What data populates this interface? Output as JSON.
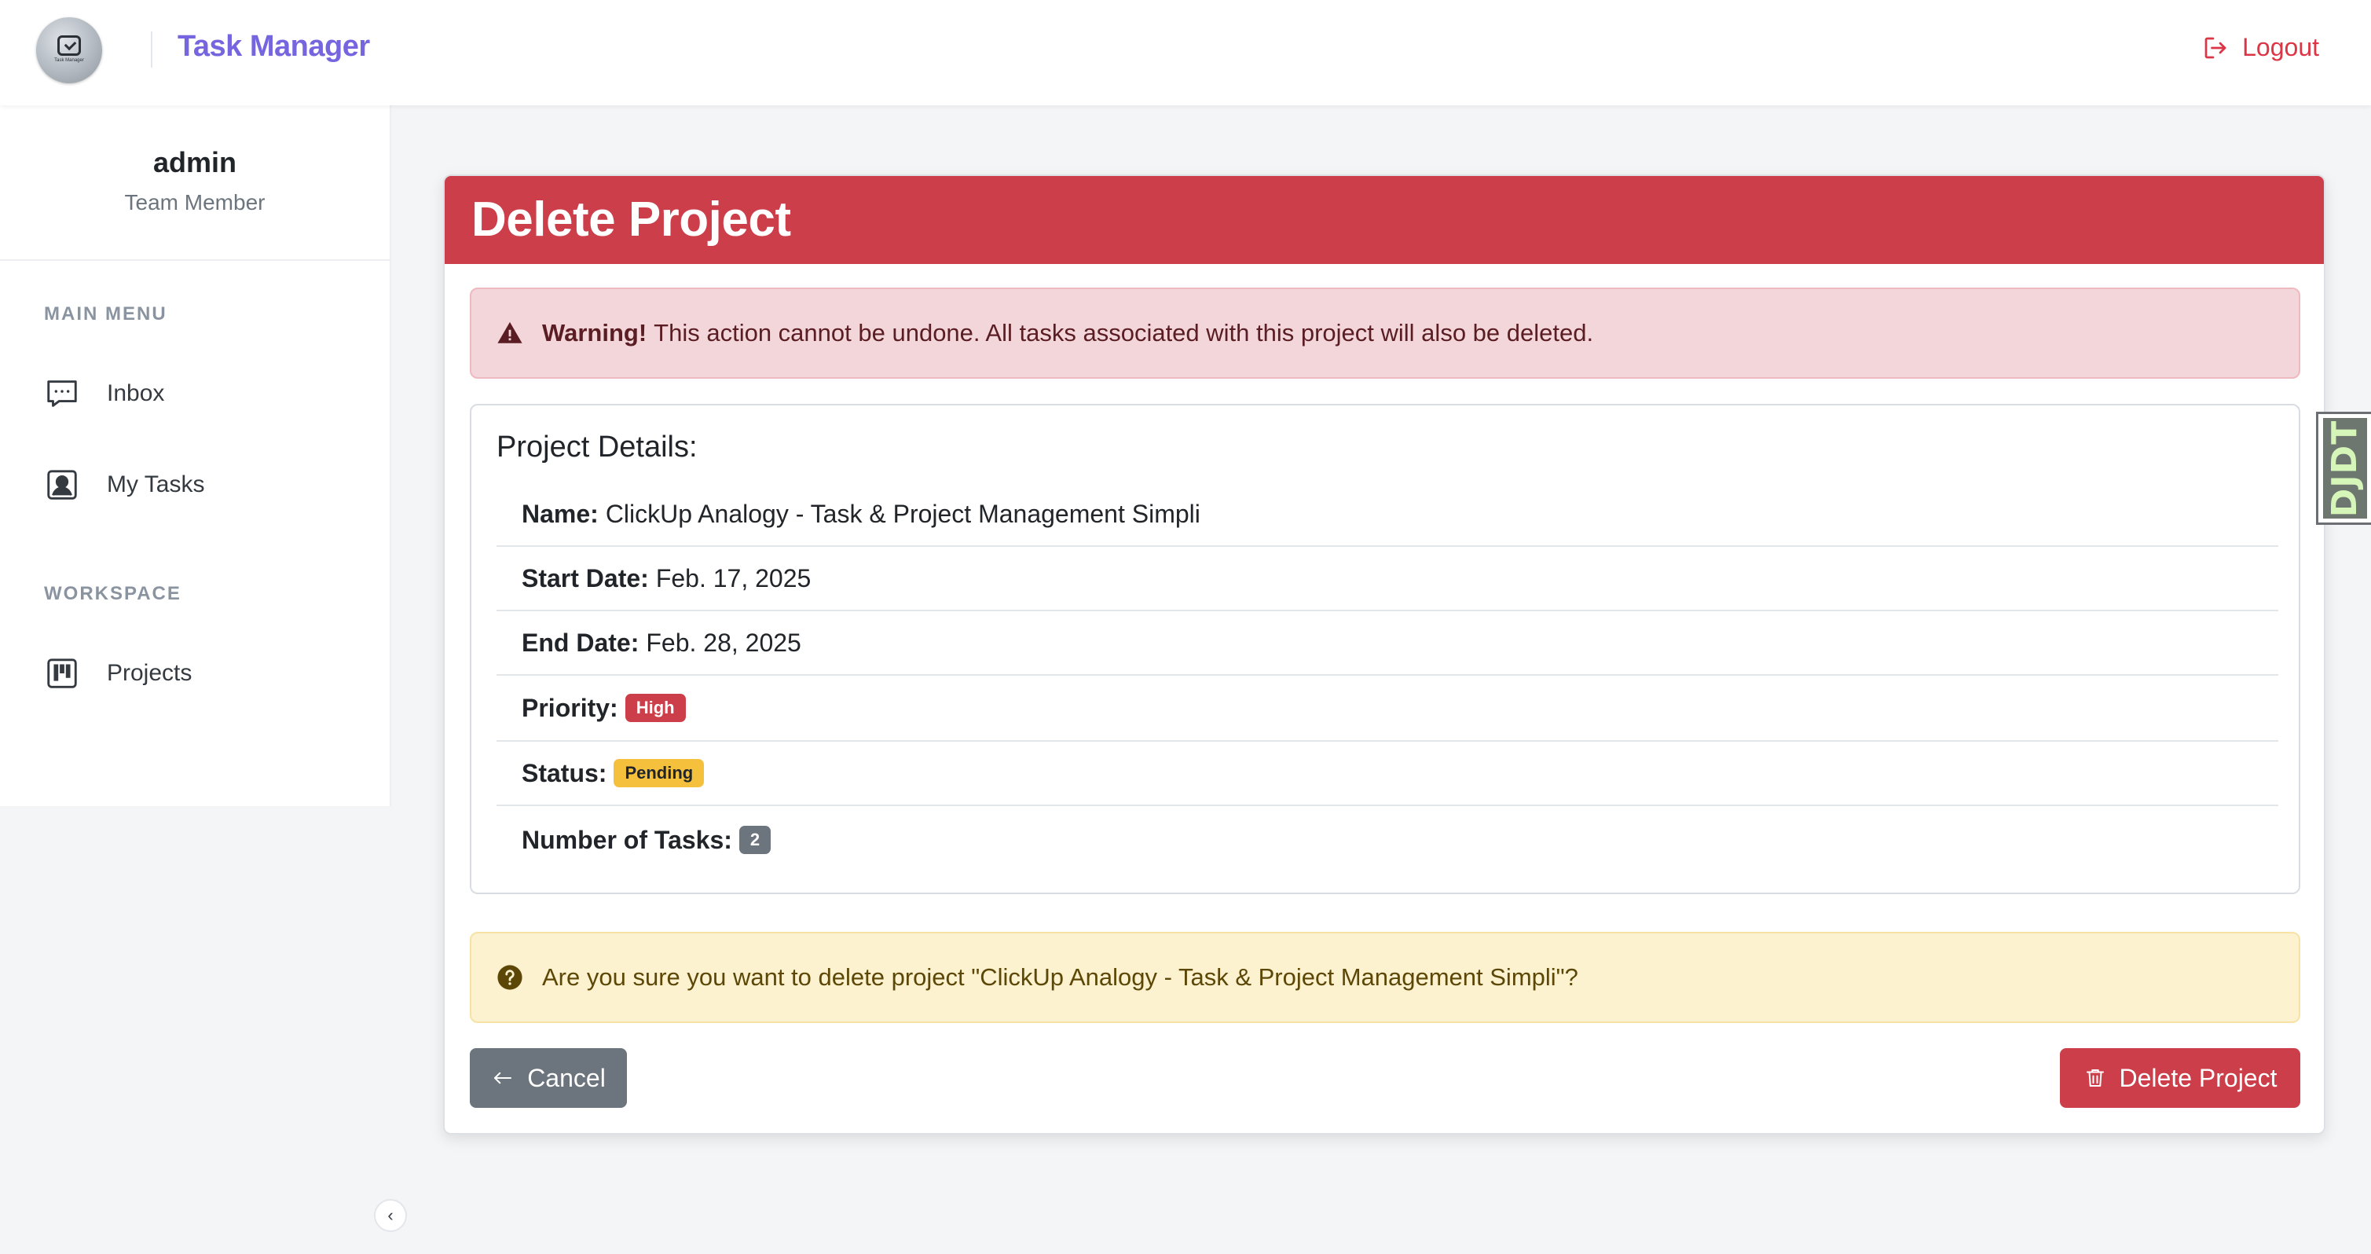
{
  "navbar": {
    "brand_title": "Task Manager",
    "logo_text": "Task Manager",
    "logout_label": "Logout",
    "accent_color": "#7566e0"
  },
  "sidebar": {
    "username": "admin",
    "role": "Team Member",
    "sections": [
      {
        "heading": "MAIN MENU",
        "items": [
          {
            "label": "Inbox",
            "icon": "chat-dots-icon"
          },
          {
            "label": "My Tasks",
            "icon": "person-badge-icon"
          }
        ]
      },
      {
        "heading": "WORKSPACE",
        "items": [
          {
            "label": "Projects",
            "icon": "kanban-icon"
          }
        ]
      }
    ],
    "collapse_glyph": "‹"
  },
  "card": {
    "title": "Delete Project",
    "header_color": "#cc3e4a",
    "warning": {
      "strong": "Warning!",
      "text": "This action cannot be undone. All tasks associated with this project will also be deleted."
    },
    "details": {
      "title": "Project Details:",
      "name_label": "Name:",
      "name_value": "ClickUp Analogy - Task & Project Management Simpli",
      "start_label": "Start Date:",
      "start_value": "Feb. 17, 2025",
      "end_label": "End Date:",
      "end_value": "Feb. 28, 2025",
      "priority_label": "Priority:",
      "priority_value": "High",
      "status_label": "Status:",
      "status_value": "Pending",
      "tasks_label": "Number of Tasks:",
      "tasks_value": "2"
    },
    "confirm_text": "Are you sure you want to delete project \"ClickUp Analogy - Task & Project Management Simpli\"?",
    "cancel_label": "Cancel",
    "delete_label": "Delete Project"
  },
  "djdt": {
    "label": "DJDT"
  }
}
